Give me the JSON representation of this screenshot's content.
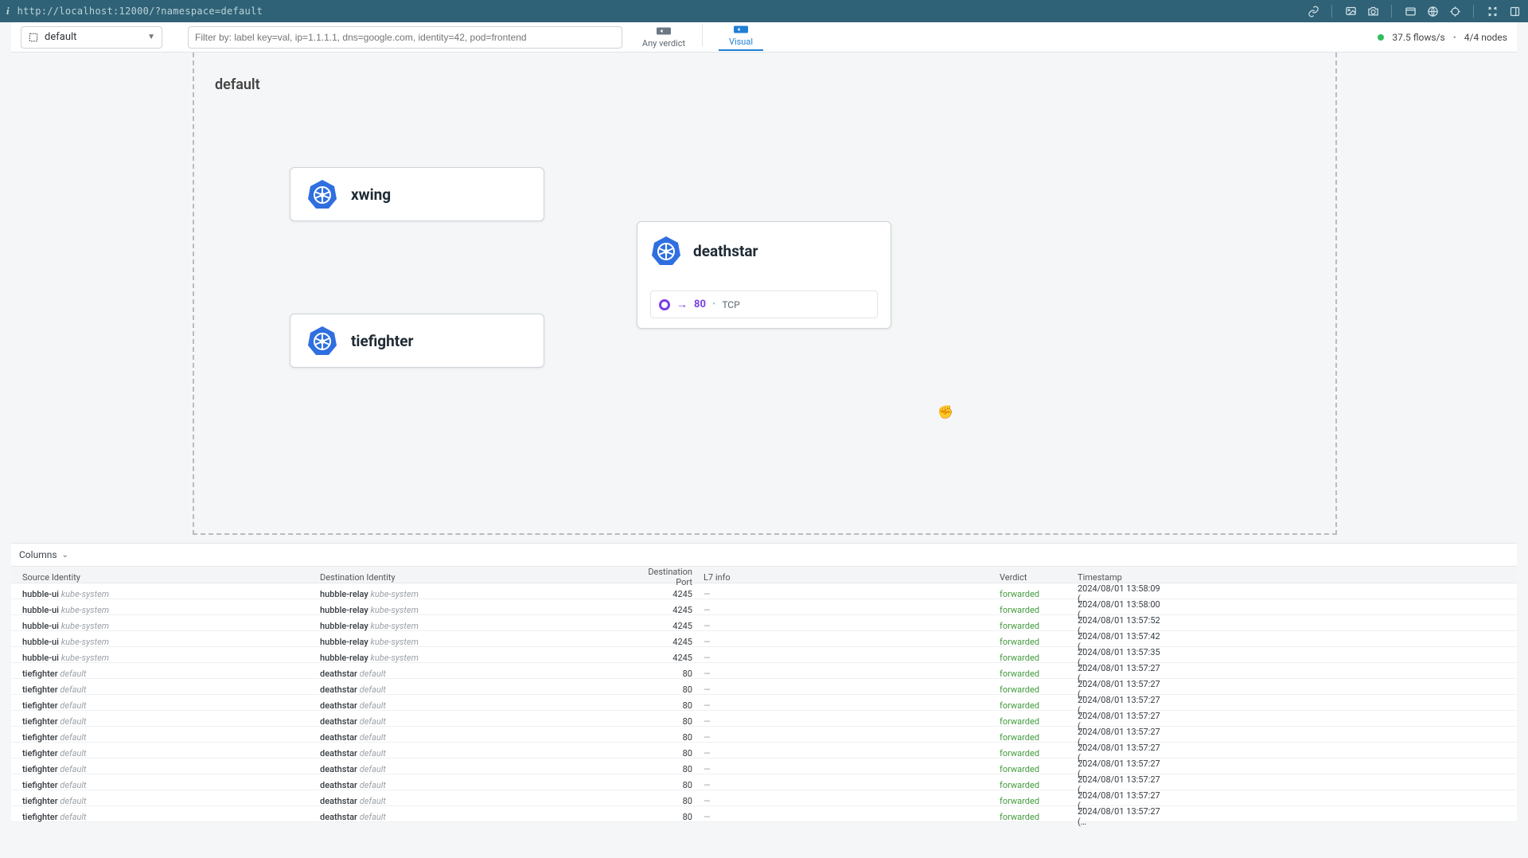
{
  "titlebar": {
    "url": "http://localhost:12000/?namespace=default"
  },
  "toolbar": {
    "namespace": "default",
    "filter_placeholder": "Filter by: label key=val, ip=1.1.1.1, dns=google.com, identity=42, pod=frontend",
    "tab_any_verdict": "Any verdict",
    "tab_visual": "Visual",
    "flows_rate": "37.5 flows/s",
    "nodes": "4/4 nodes"
  },
  "canvas": {
    "namespace_label": "default",
    "services": {
      "xwing": "xwing",
      "tiefighter": "tiefighter",
      "deathstar": "deathstar"
    },
    "deathstar_port": {
      "port": "80",
      "proto": "TCP"
    }
  },
  "flows_panel": {
    "columns_label": "Columns",
    "headers": {
      "src": "Source Identity",
      "dst": "Destination Identity",
      "port": "Destination Port",
      "l7": "L7 info",
      "verdict": "Verdict",
      "ts": "Timestamp"
    },
    "rows": [
      {
        "src": "hubble-ui",
        "src_ns": "kube-system",
        "dst": "hubble-relay",
        "dst_ns": "kube-system",
        "port": "4245",
        "l7": "—",
        "verdict": "forwarded",
        "ts": "2024/08/01 13:58:09 (…"
      },
      {
        "src": "hubble-ui",
        "src_ns": "kube-system",
        "dst": "hubble-relay",
        "dst_ns": "kube-system",
        "port": "4245",
        "l7": "—",
        "verdict": "forwarded",
        "ts": "2024/08/01 13:58:00 (…"
      },
      {
        "src": "hubble-ui",
        "src_ns": "kube-system",
        "dst": "hubble-relay",
        "dst_ns": "kube-system",
        "port": "4245",
        "l7": "—",
        "verdict": "forwarded",
        "ts": "2024/08/01 13:57:52 (…"
      },
      {
        "src": "hubble-ui",
        "src_ns": "kube-system",
        "dst": "hubble-relay",
        "dst_ns": "kube-system",
        "port": "4245",
        "l7": "—",
        "verdict": "forwarded",
        "ts": "2024/08/01 13:57:42 (…"
      },
      {
        "src": "hubble-ui",
        "src_ns": "kube-system",
        "dst": "hubble-relay",
        "dst_ns": "kube-system",
        "port": "4245",
        "l7": "—",
        "verdict": "forwarded",
        "ts": "2024/08/01 13:57:35 (…"
      },
      {
        "src": "tiefighter",
        "src_ns": "default",
        "dst": "deathstar",
        "dst_ns": "default",
        "port": "80",
        "l7": "—",
        "verdict": "forwarded",
        "ts": "2024/08/01 13:57:27 (…"
      },
      {
        "src": "tiefighter",
        "src_ns": "default",
        "dst": "deathstar",
        "dst_ns": "default",
        "port": "80",
        "l7": "—",
        "verdict": "forwarded",
        "ts": "2024/08/01 13:57:27 (…"
      },
      {
        "src": "tiefighter",
        "src_ns": "default",
        "dst": "deathstar",
        "dst_ns": "default",
        "port": "80",
        "l7": "—",
        "verdict": "forwarded",
        "ts": "2024/08/01 13:57:27 (…"
      },
      {
        "src": "tiefighter",
        "src_ns": "default",
        "dst": "deathstar",
        "dst_ns": "default",
        "port": "80",
        "l7": "—",
        "verdict": "forwarded",
        "ts": "2024/08/01 13:57:27 (…"
      },
      {
        "src": "tiefighter",
        "src_ns": "default",
        "dst": "deathstar",
        "dst_ns": "default",
        "port": "80",
        "l7": "—",
        "verdict": "forwarded",
        "ts": "2024/08/01 13:57:27 (…"
      },
      {
        "src": "tiefighter",
        "src_ns": "default",
        "dst": "deathstar",
        "dst_ns": "default",
        "port": "80",
        "l7": "—",
        "verdict": "forwarded",
        "ts": "2024/08/01 13:57:27 (…"
      },
      {
        "src": "tiefighter",
        "src_ns": "default",
        "dst": "deathstar",
        "dst_ns": "default",
        "port": "80",
        "l7": "—",
        "verdict": "forwarded",
        "ts": "2024/08/01 13:57:27 (…"
      },
      {
        "src": "tiefighter",
        "src_ns": "default",
        "dst": "deathstar",
        "dst_ns": "default",
        "port": "80",
        "l7": "—",
        "verdict": "forwarded",
        "ts": "2024/08/01 13:57:27 (…"
      },
      {
        "src": "tiefighter",
        "src_ns": "default",
        "dst": "deathstar",
        "dst_ns": "default",
        "port": "80",
        "l7": "—",
        "verdict": "forwarded",
        "ts": "2024/08/01 13:57:27 (…"
      },
      {
        "src": "tiefighter",
        "src_ns": "default",
        "dst": "deathstar",
        "dst_ns": "default",
        "port": "80",
        "l7": "—",
        "verdict": "forwarded",
        "ts": "2024/08/01 13:57:27 (…"
      }
    ]
  }
}
